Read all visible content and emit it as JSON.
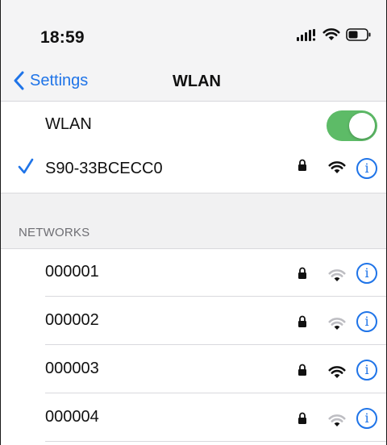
{
  "status_bar": {
    "time": "18:59"
  },
  "nav": {
    "back_label": "Settings",
    "title": "WLAN"
  },
  "wlan_toggle": {
    "label": "WLAN",
    "on": true,
    "on_color": "#5dbb67"
  },
  "connected_network": {
    "name": "S90-33BCECC0",
    "secured": true,
    "signal": "full",
    "selected": true
  },
  "networks_section": {
    "header": "NETWORKS",
    "items": [
      {
        "name": "000001",
        "secured": true,
        "signal": "weak"
      },
      {
        "name": "000002",
        "secured": true,
        "signal": "weak"
      },
      {
        "name": "000003",
        "secured": true,
        "signal": "full"
      },
      {
        "name": "000004",
        "secured": true,
        "signal": "weak"
      }
    ]
  },
  "colors": {
    "accent": "#1f74e8",
    "toggle_on": "#5dbb67"
  }
}
